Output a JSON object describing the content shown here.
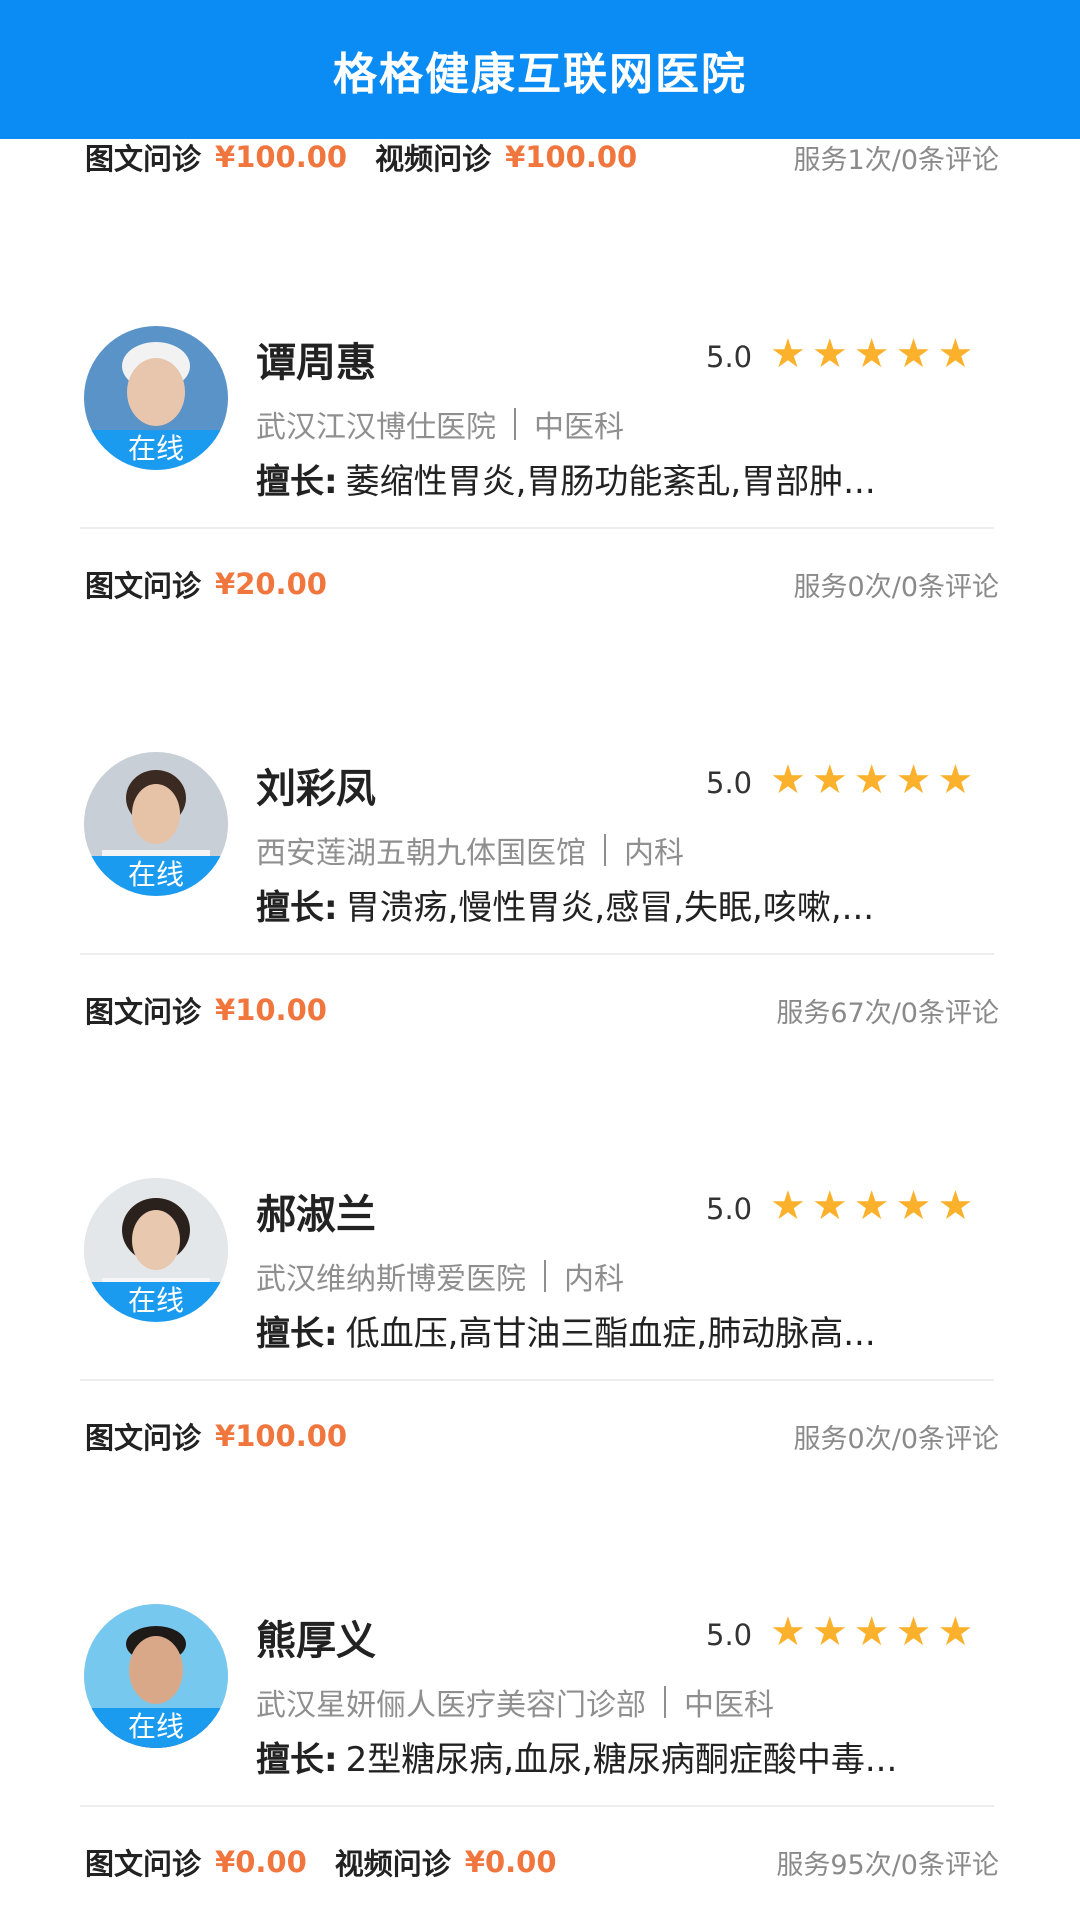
{
  "header": {
    "title": "格格健康互联网医院"
  },
  "first_service": {
    "items": [
      {
        "label": "图文问诊",
        "price": "¥100.00"
      },
      {
        "label": "视频问诊",
        "price": "¥100.00"
      }
    ],
    "stats": "服务1次/0条评论"
  },
  "doctors": [
    {
      "name": "谭周惠",
      "rating": "5.0",
      "stars": 5,
      "hospital": "武汉江汉博仕医院",
      "department": "中医科",
      "skill_label": "擅长:",
      "skill": "萎缩性胃炎,胃肠功能紊乱,胃部肿...",
      "status": "在线",
      "services": [
        {
          "label": "图文问诊",
          "price": "¥20.00"
        }
      ],
      "stats": "服务0次/0条评论"
    },
    {
      "name": "刘彩凤",
      "rating": "5.0",
      "stars": 5,
      "hospital": "西安莲湖五朝九体国医馆",
      "department": "内科",
      "skill_label": "擅长:",
      "skill": "胃溃疡,慢性胃炎,感冒,失眠,咳嗽,...",
      "status": "在线",
      "services": [
        {
          "label": "图文问诊",
          "price": "¥10.00"
        }
      ],
      "stats": "服务67次/0条评论"
    },
    {
      "name": "郝淑兰",
      "rating": "5.0",
      "stars": 5,
      "hospital": "武汉维纳斯博爱医院",
      "department": "内科",
      "skill_label": "擅长:",
      "skill": "低血压,高甘油三酯血症,肺动脉高...",
      "status": "在线",
      "services": [
        {
          "label": "图文问诊",
          "price": "¥100.00"
        }
      ],
      "stats": "服务0次/0条评论"
    },
    {
      "name": "熊厚义",
      "rating": "5.0",
      "stars": 5,
      "hospital": "武汉星妍俪人医疗美容门诊部",
      "department": "中医科",
      "skill_label": "擅长:",
      "skill": "2型糖尿病,血尿,糖尿病酮症酸中毒...",
      "status": "在线",
      "services": [
        {
          "label": "图文问诊",
          "price": "¥0.00"
        },
        {
          "label": "视频问诊",
          "price": "¥0.00"
        }
      ],
      "stats": "服务95次/0条评论"
    }
  ]
}
